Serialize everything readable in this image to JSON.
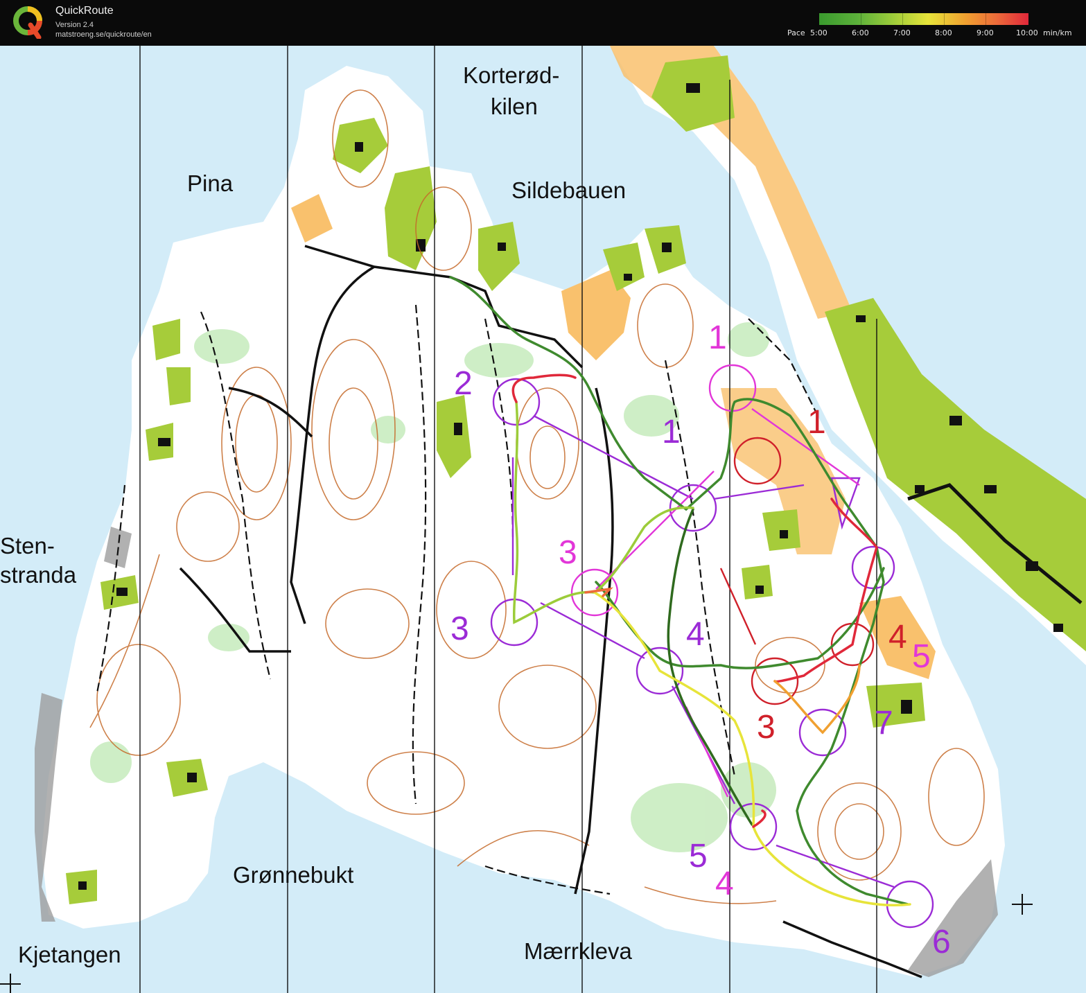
{
  "app": {
    "name": "QuickRoute",
    "version": "Version 2.4",
    "url": "matstroeng.se/quickroute/en"
  },
  "pace_legend": {
    "label": "Pace",
    "ticks": [
      "5:00",
      "6:00",
      "7:00",
      "8:00",
      "9:00",
      "10:00"
    ],
    "unit": "min/km",
    "colors": [
      "#3a9a2e",
      "#9ccc3a",
      "#e7e43a",
      "#f0a030",
      "#e0283a"
    ]
  },
  "map": {
    "colors": {
      "water": "#d3ecf8",
      "land": "#ffffff",
      "open_land": "#f9c16d",
      "vegetation": "#a6cc3a",
      "contour": "#c56a2a",
      "course_purple": "#9b2bd6",
      "course_magenta": "#e236d8",
      "course_red": "#d0202a",
      "route_green": "#3f8a2e"
    },
    "place_names": {
      "korterod": "Korterød-",
      "kilen": "kilen",
      "pina": "Pina",
      "sildebauen": "Sildebauen",
      "sten": "Sten-",
      "stranda": "stranda",
      "gronnebukt": "Grønnebukt",
      "kjetangen": "Kjetangen",
      "maerrkleva": "Mærrkleva"
    },
    "controls": {
      "purple": [
        "2",
        "1",
        "3",
        "3",
        "4",
        "5",
        "6",
        "7"
      ],
      "magenta": [
        "1",
        "5",
        "4"
      ],
      "red": [
        "1",
        "3",
        "4"
      ]
    }
  }
}
